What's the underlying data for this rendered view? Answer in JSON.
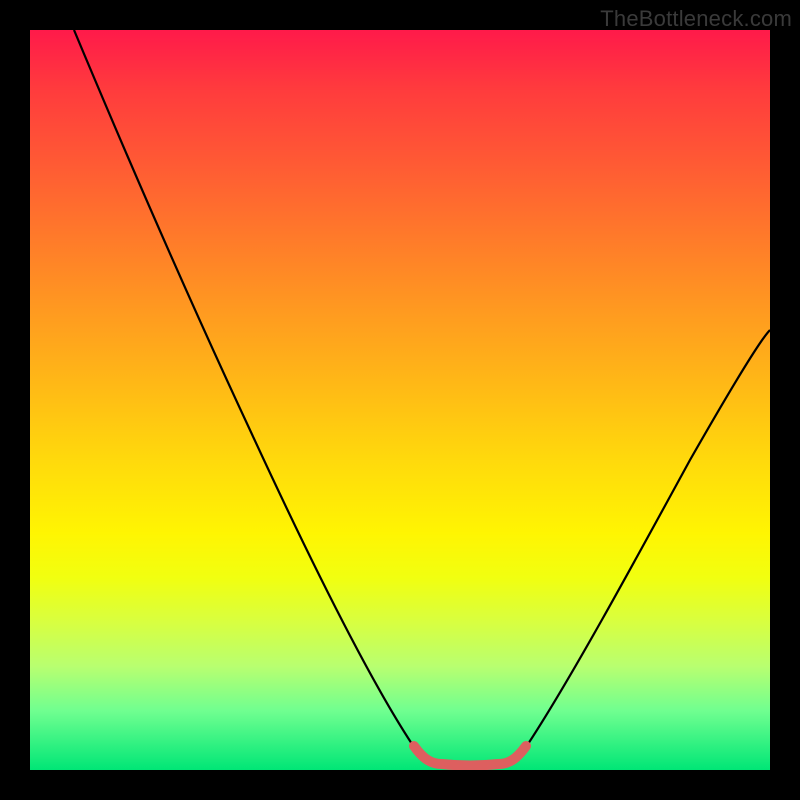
{
  "attribution": "TheBottleneck.com",
  "chart_data": {
    "type": "line",
    "title": "",
    "xlabel": "",
    "ylabel": "",
    "xlim": [
      0,
      100
    ],
    "ylim": [
      0,
      100
    ],
    "grid": false,
    "legend": false,
    "series": [
      {
        "name": "black-curve",
        "stroke": "#000000",
        "x": [
          6,
          12,
          18,
          24,
          30,
          36,
          42,
          48,
          53,
          55,
          57,
          59,
          61,
          63,
          65,
          70,
          76,
          82,
          88,
          94,
          100
        ],
        "y": [
          100,
          85,
          71,
          57,
          44,
          32,
          21,
          11,
          3,
          1,
          0.5,
          0.5,
          0.5,
          1,
          3,
          11,
          21,
          31,
          41,
          50,
          59
        ]
      },
      {
        "name": "red-band",
        "stroke": "#e06060",
        "x": [
          53,
          55,
          57,
          59,
          61,
          63,
          65
        ],
        "y": [
          3,
          1,
          0.6,
          0.5,
          0.6,
          1,
          3
        ]
      }
    ],
    "gradient_stops": [
      {
        "pos": 0,
        "color": "#ff1a4a"
      },
      {
        "pos": 18,
        "color": "#ff5a34"
      },
      {
        "pos": 38,
        "color": "#ff9a20"
      },
      {
        "pos": 58,
        "color": "#ffd90c"
      },
      {
        "pos": 74,
        "color": "#f1ff10"
      },
      {
        "pos": 92,
        "color": "#70ff90"
      },
      {
        "pos": 100,
        "color": "#00e676"
      }
    ]
  }
}
